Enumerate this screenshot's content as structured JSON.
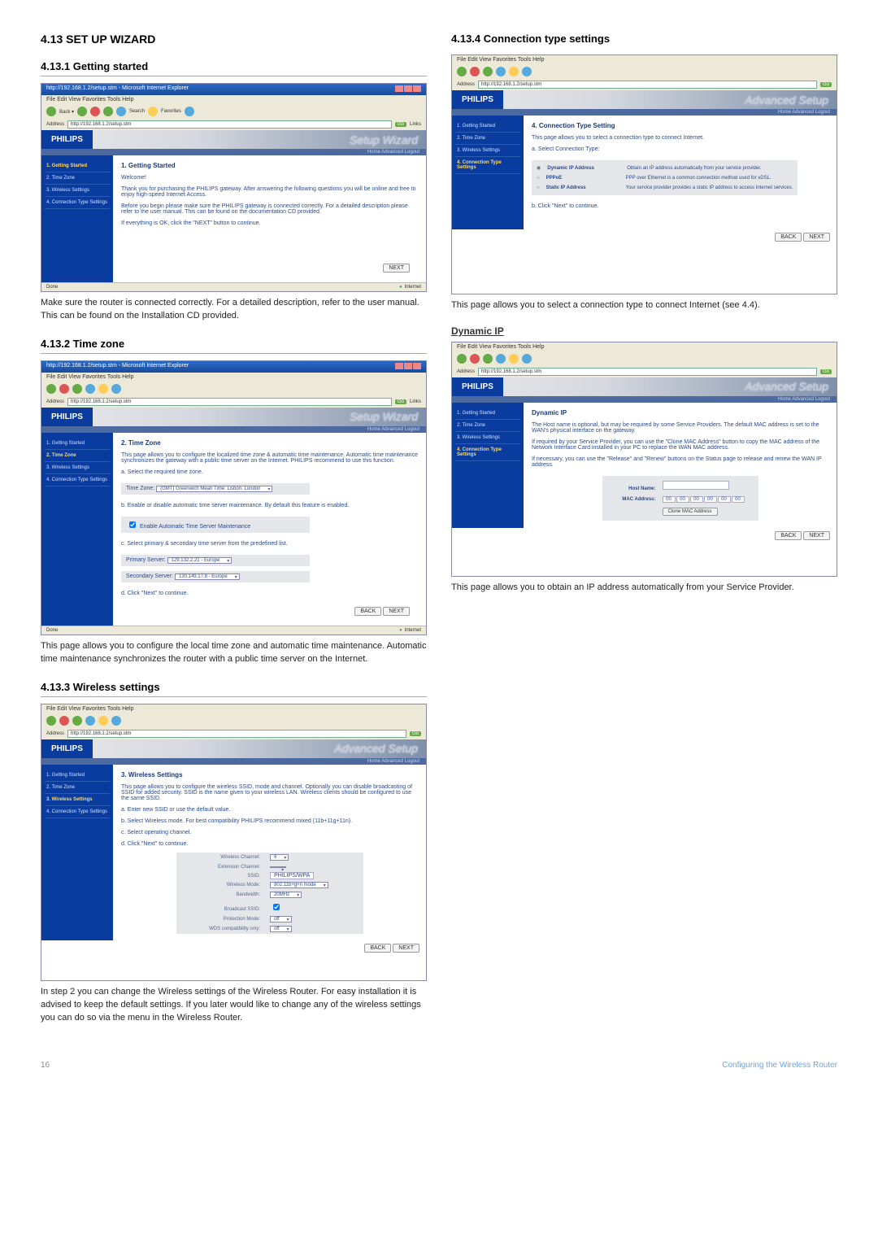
{
  "page": {
    "number": "16",
    "footer_title": "Configuring the Wireless Router"
  },
  "col_left": {
    "h_main": "4.13  SET UP WIZARD",
    "s1": {
      "title": "4.13.1  Getting started",
      "caption": "Make sure the router is connected correctly. For a detailed description, refer to the user manual. This can be found on the Installation CD provided.",
      "shot": {
        "titlebar": "http://192.168.1.2/setup.stm - Microsoft Internet Explorer",
        "menu": "File   Edit   View   Favorites   Tools   Help",
        "address": "http://192.168.1.2/setup.stm",
        "wizard": "Setup Wizard",
        "status_done": "Done",
        "status_internet": "Internet",
        "philips": "PHILIPS",
        "crumb": "Home  Advanced  Logout",
        "sidebar": [
          "1. Getting Started",
          "2. Time Zone",
          "3. Wireless Settings",
          "4. Connection Type Settings"
        ],
        "content_title": "1. Getting Started",
        "p1": "Welcome!",
        "p2": "Thank you for purchasing the PHILIPS gateway. After answering the following questions you will be online and free to enjoy high-speed Internet Access.",
        "p3": "Before you begin please make sure the PHILIPS gateway is connected correctly. For a detailed description please refer to the user manual. This can be found on the documentation CD provided.",
        "p4": "If everything is OK, click the \"NEXT\" button to continue.",
        "next": "NEXT"
      }
    },
    "s2": {
      "title": "4.13.2  Time zone",
      "caption": "This page allows you to configure the local time zone and automatic time maintenance. Automatic time maintenance synchronizes the router with a public time server on the Internet.",
      "shot": {
        "content_title": "2. Time Zone",
        "p1": "This page allows you to configure the localized time zone & automatic time maintenance. Automatic time maintenance synchronizes the gateway with a public time server on the Internet. PHILIPS recommend to use this function.",
        "a": "a. Select the required time zone.",
        "tz_label": "Time Zone:",
        "tz_value": "(GMT) Greenwich Mean Time: Lisbon, London",
        "b": "b. Enable or disable automatic time server maintenance. By default this feature is enabled.",
        "cb": "Enable Automatic Time Server Maintenance",
        "c": "c. Select primary & secondary time server from the predefined list.",
        "primary_label": "Primary Server:",
        "primary_value": "129.132.2.21 - Europe",
        "secondary_label": "Secondary Server:",
        "secondary_value": "130.149.17.8 - Europe",
        "d": "d. Click \"Next\" to continue.",
        "back": "BACK",
        "next": "NEXT"
      }
    },
    "s3": {
      "title": "4.13.3  Wireless settings",
      "caption": "In step 2 you can change the Wireless settings of the Wireless Router. For easy installation it is advised to keep the default settings. If you later would like to change any of the wireless settings you can do so via the menu in the Wireless Router.",
      "shot": {
        "wizard": "Advanced Setup",
        "content_title": "3. Wireless Settings",
        "p1": "This page allows you to configure the wireless SSID, mode and channel. Optionally you can disable broadcasting of SSID for added security. SSID is the name given to your wireless LAN. Wireless clients should be configured to use the same SSID.",
        "a": "a. Enter new SSID or use the default value.",
        "b": "b. Select Wireless mode. For best compatibility PHILIPS recommend mixed (11b+11g+11n).",
        "c": "c. Select operating channel.",
        "d": "d. Click \"Next\" to continue.",
        "rows": {
          "chan_label": "Wireless Channel:",
          "chan_value": "6",
          "ext_label": "Extension Channel:",
          "ext_value": "",
          "ssid_label": "SSID:",
          "ssid_value": "PHILIPS/WPA",
          "mode_label": "Wireless Mode:",
          "mode_value": "802.11b+g+n mode",
          "band_label": "Bandwidth:",
          "band_value": "20MHz",
          "bcast_label": "Broadcast SSID:",
          "bcast_value": "",
          "prot_label": "Protection Mode:",
          "prot_value": "off",
          "wds_label": "WDS compatibility only:",
          "wds_value": "off"
        },
        "back": "BACK",
        "next": "NEXT"
      }
    }
  },
  "col_right": {
    "s4": {
      "title": "4.13.4  Connection type settings",
      "caption": "This page allows you to select a connection type to connect Internet (see 4.4).",
      "shot": {
        "wizard": "Advanced Setup",
        "content_title": "4. Connection Type Setting",
        "p1": "This page allows you to select a connection type to connect Internet.",
        "a": "a. Select Connection Type:",
        "opts": [
          {
            "name": "Dynamic IP Address",
            "desc": "Obtain an IP address automatically from your service provider."
          },
          {
            "name": "PPPoE",
            "desc": "PPP over Ethernet is a common connection method used for xDSL."
          },
          {
            "name": "Static IP Address",
            "desc": "Your service provider provides a static IP address to access Internet services."
          }
        ],
        "b": "b. Click \"Next\" to continue.",
        "back": "BACK",
        "next": "NEXT"
      }
    },
    "dyn_title": "Dynamic IP",
    "dyn_caption": "This page allows you to obtain an IP address automatically from your Service Provider.",
    "dyn_shot": {
      "wizard": "Advanced Setup",
      "content_title": "Dynamic IP",
      "p1": "The Host name is optional, but may be required by some Service Providers. The default MAC address is set to the WAN's physical interface on the gateway.",
      "p2": "If required by your Service Provider, you can use the \"Clone MAC Address\" button to copy the MAC address of the Network Interface Card installed in your PC to replace the WAN MAC address.",
      "p3": "If necessary, you can use the \"Release\" and \"Renew\" buttons on the Status page to release and renew the WAN IP address.",
      "host_label": "Host Name:",
      "mac_label": "MAC Address:",
      "mac": [
        "00",
        "00",
        "00",
        "00",
        "00",
        "00"
      ],
      "clone": "Clone MAC Address",
      "back": "BACK",
      "next": "NEXT"
    }
  }
}
